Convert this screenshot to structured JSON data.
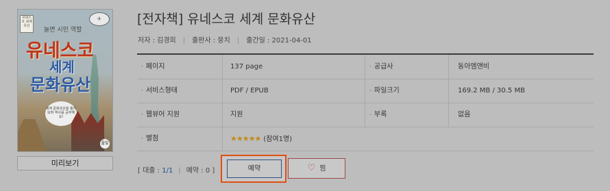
{
  "cover": {
    "badge": "유네스코 세계유산",
    "tagline": "놀면 시민 역할",
    "title_line1": "유네스코",
    "title_line2": "세계",
    "title_line3": "문화유산",
    "bubble": "세계 문화유산을 둘러보며 역사를 공부해요!",
    "publisher_logo": "풀빛"
  },
  "preview_button": "미리보기",
  "book": {
    "title": "[전자책] 유네스코 세계 문화유산",
    "author": "저자 : 김경희",
    "publisher": "출판사 : 뭉치",
    "date": "출간일 : 2021-04-01"
  },
  "details": {
    "rows": [
      {
        "l1": "페이지",
        "v1": "137 page",
        "l2": "공급사",
        "v2": "동아엠앤비"
      },
      {
        "l1": "서비스형태",
        "v1": "PDF / EPUB",
        "l2": "파일크기",
        "v2": "169.2 MB / 30.5 MB"
      },
      {
        "l1": "웹뷰어 지원",
        "v1": "지원",
        "l2": "부록",
        "v2": "없음"
      },
      {
        "l1": "별점",
        "stars": "★★★★★",
        "v1": "(참여1명)"
      }
    ]
  },
  "loan": {
    "open": "[ 대출 :",
    "loan_value": "1/1",
    "reserve_label": "예약 :",
    "reserve_value": "0",
    "close": "]"
  },
  "actions": {
    "reserve": "예약",
    "wish": "찜"
  },
  "colors": {
    "highlight": "#e05012",
    "heart": "#b23b3b",
    "link_number": "#1d4a8c"
  }
}
